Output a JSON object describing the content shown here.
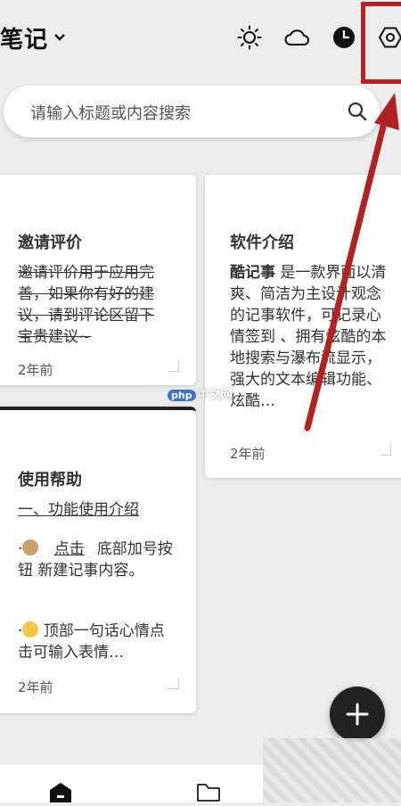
{
  "header": {
    "title": "笔记",
    "icons": [
      "chevron-down-icon",
      "sun-icon",
      "cloud-icon",
      "clock-icon",
      "settings-icon"
    ]
  },
  "search": {
    "placeholder": "请输入标题或内容搜索"
  },
  "cards": [
    {
      "title": "邀请评价",
      "body": "邀请评价用于应用完善，如果你有好的建议，请到评论区留下宝贵建议~",
      "time": "2年前"
    },
    {
      "title": "软件介绍",
      "body_lead": "酷记事",
      "body": " 是一款界面以清爽、简洁为主设计观念的记事软件，可记录心情签到 、拥有炫酷的本地搜索与瀑布流显示，强大的文本编辑功能、炫酷…",
      "time": "2年前"
    },
    {
      "title": "使用帮助",
      "subtitle": "一、功能使用介绍",
      "item1_prefix": "·",
      "item1_link": "点击",
      "item1_text": "底部加号按钮 新建记事内容。",
      "item2_prefix": "·",
      "item2_text": "顶部一句话心情点击可输入表情…",
      "time": "2年前"
    }
  ],
  "watermark": {
    "badge": "php",
    "text": "中文网"
  },
  "colors": {
    "accent_red": "#b22222",
    "fab": "#222222",
    "background": "#ececec"
  }
}
